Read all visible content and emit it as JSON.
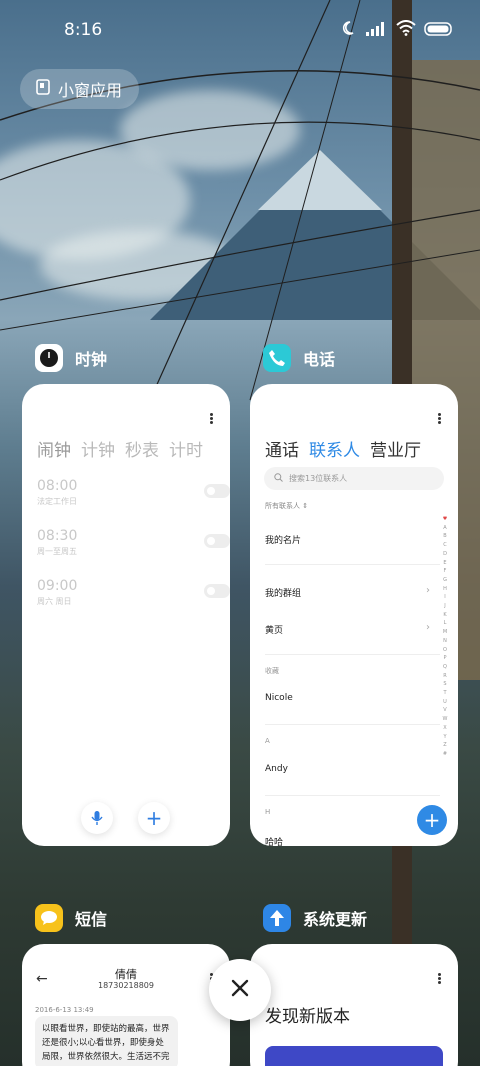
{
  "status_bar": {
    "time": "8:16",
    "icons": [
      "moon-icon",
      "signal-icon",
      "wifi-icon",
      "battery-icon"
    ]
  },
  "small_window": {
    "label": "小窗应用",
    "icon": "small-window-icon"
  },
  "apps": {
    "clock": {
      "name": "时钟",
      "icon": "clock-icon",
      "tabs": [
        "闹钟",
        "计钟",
        "秒表",
        "计时"
      ],
      "alarms": [
        {
          "time": "08:00",
          "repeat": "法定工作日",
          "enabled": false
        },
        {
          "time": "08:30",
          "repeat": "周一至周五",
          "enabled": false
        },
        {
          "time": "09:00",
          "repeat": "周六 周日",
          "enabled": false
        }
      ],
      "buttons": {
        "mic_icon": "microphone-icon",
        "add_icon": "plus-icon",
        "add_symbol": "+"
      }
    },
    "phone": {
      "name": "电话",
      "icon": "phone-icon",
      "tabs": [
        "通话",
        "联系人",
        "营业厅"
      ],
      "active_tab": "联系人",
      "search_placeholder": "搜索13位联系人",
      "filter_label": "所有联系人",
      "rows": {
        "my_card": "我的名片",
        "my_groups": "我的群组",
        "yellow_pages": "黄页",
        "favorites_label": "收藏",
        "favorite_1": "Nicole",
        "section_a": "A",
        "contact_a": "Andy",
        "section_h": "H",
        "contact_h": "哈哈"
      },
      "alpha_index": [
        "♥",
        "A",
        "B",
        "C",
        "D",
        "E",
        "F",
        "G",
        "H",
        "I",
        "J",
        "K",
        "L",
        "M",
        "N",
        "O",
        "P",
        "Q",
        "R",
        "S",
        "T",
        "U",
        "V",
        "W",
        "X",
        "Y",
        "Z",
        "#"
      ],
      "fab_symbol": "+"
    },
    "sms": {
      "name": "短信",
      "icon": "message-icon",
      "contact_name": "倩倩",
      "contact_number": "18730218809",
      "date": "2016-6-13 13:49",
      "message": "以眼看世界，即使站的最高，世界还是很小;以心看世界，即使身处局限，世界依然很大。生活远不完"
    },
    "update": {
      "name": "系统更新",
      "icon": "update-arrow-icon",
      "title": "发现新版本"
    }
  },
  "close_button": {
    "icon": "close-icon"
  },
  "colors": {
    "accent_blue": "#2f8ae5",
    "clock_icon_bg": "#ffffff",
    "phone_icon_bg": "#2cc9d6",
    "sms_icon_bg": "#f7c21b",
    "update_icon_bg": "#2e86e6"
  }
}
